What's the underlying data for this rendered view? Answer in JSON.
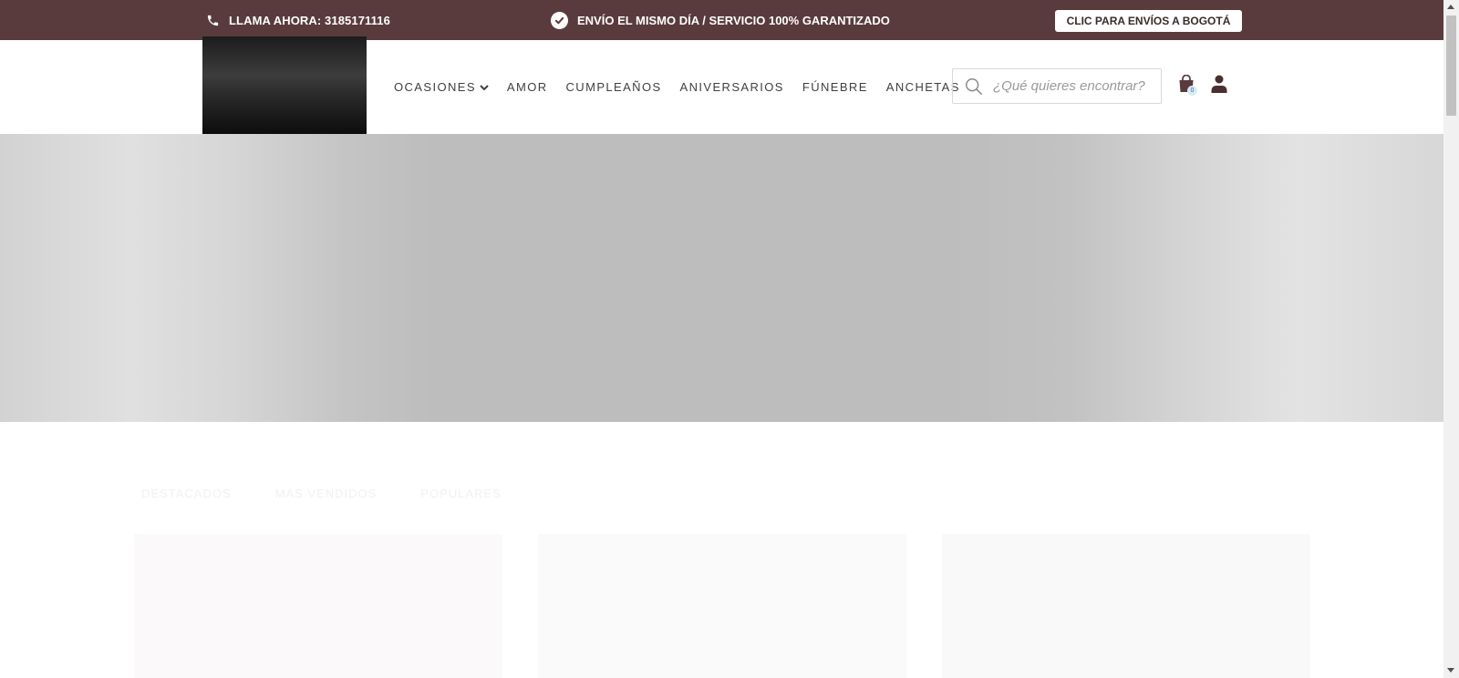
{
  "topbar": {
    "phone_text": "LLAMA AHORA: 3185171116",
    "promo_text": "ENVÍO EL MISMO DÍA / SERVICIO 100% GARANTIZADO",
    "ship_button": "CLIC PARA ENVÍOS A BOGOTÁ",
    "background_color": "#5a3b3d"
  },
  "nav": {
    "items": [
      {
        "label": "OCASIONES",
        "has_dropdown": true
      },
      {
        "label": "AMOR"
      },
      {
        "label": "CUMPLEAÑOS"
      },
      {
        "label": "ANIVERSARIOS"
      },
      {
        "label": "FÚNEBRE"
      },
      {
        "label": "ANCHETAS"
      }
    ]
  },
  "search": {
    "placeholder": "¿Qué quieres encontrar?",
    "value": ""
  },
  "cart": {
    "count": "0",
    "icon": "shopping-bag-icon"
  },
  "account": {
    "icon": "user-icon"
  },
  "tabs": [
    {
      "label": "DESTACADOS"
    },
    {
      "label": "MÁS VENDIDOS"
    },
    {
      "label": "POPULARES"
    }
  ]
}
